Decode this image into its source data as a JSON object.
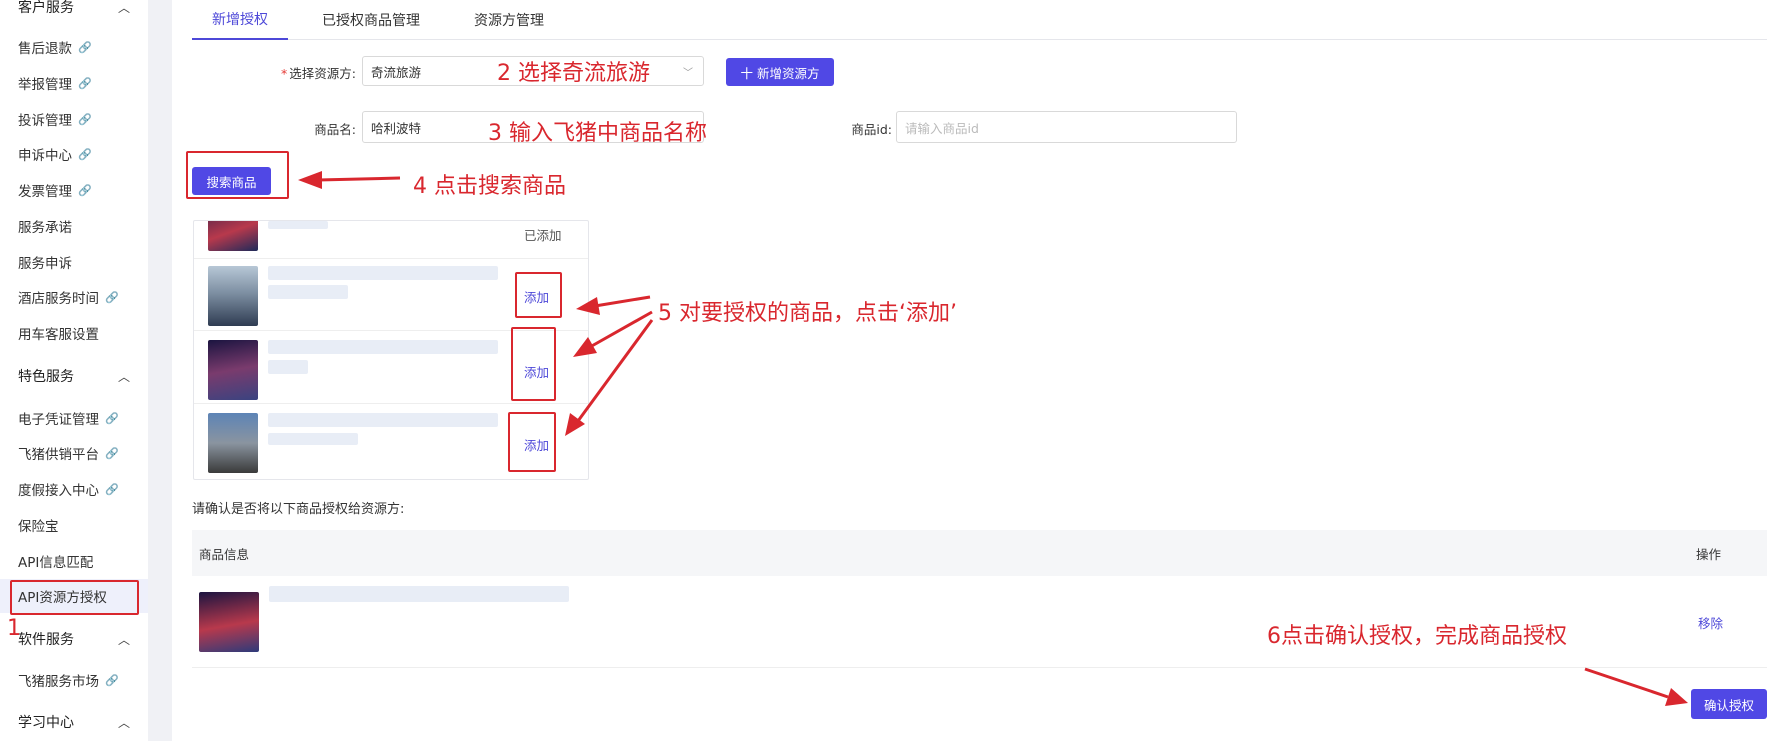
{
  "sidebar": {
    "sections": [
      {
        "label": "客户服务",
        "items": [
          {
            "label": "售后退款",
            "link": true
          },
          {
            "label": "举报管理",
            "link": true
          },
          {
            "label": "投诉管理",
            "link": true
          },
          {
            "label": "申诉中心",
            "link": true
          },
          {
            "label": "发票管理",
            "link": true
          },
          {
            "label": "服务承诺",
            "link": false
          },
          {
            "label": "服务申诉",
            "link": false
          },
          {
            "label": "酒店服务时间",
            "link": true
          },
          {
            "label": "用车客服设置",
            "link": false
          }
        ]
      },
      {
        "label": "特色服务",
        "items": [
          {
            "label": "电子凭证管理",
            "link": true
          },
          {
            "label": "飞猪供销平台",
            "link": true
          },
          {
            "label": "度假接入中心",
            "link": true
          },
          {
            "label": "保险宝",
            "link": false
          },
          {
            "label": "API信息匹配",
            "link": false
          },
          {
            "label": "API资源方授权",
            "link": false,
            "active": true
          }
        ]
      },
      {
        "label": "软件服务",
        "items": [
          {
            "label": "飞猪服务市场",
            "link": true
          }
        ]
      },
      {
        "label": "学习中心",
        "items": []
      }
    ],
    "link_icon": "🔗",
    "chevron_up": "^"
  },
  "tabs": [
    {
      "label": "新增授权",
      "active": true
    },
    {
      "label": "已授权商品管理",
      "active": false
    },
    {
      "label": "资源方管理",
      "active": false
    }
  ],
  "form": {
    "resource_label": "选择资源方:",
    "required_mark": "*",
    "resource_value": "奇流旅游",
    "add_resource_button": "十 新增资源方",
    "product_name_label": "商品名:",
    "product_name_value": "哈利波特",
    "product_id_label": "商品id:",
    "product_id_placeholder": "请输入商品id",
    "search_button": "搜索商品"
  },
  "results": {
    "added_label": "已添加",
    "add_label": "添加"
  },
  "confirm_prompt": "请确认是否将以下商品授权给资源方:",
  "table": {
    "col_info": "商品信息",
    "col_action": "操作",
    "remove_label": "移除"
  },
  "confirm_button": "确认授权",
  "annotations": {
    "step1": "1",
    "step2": "2 选择奇流旅游",
    "step3": "3 输入飞猪中商品名称",
    "step4": "4 点击搜索商品",
    "step5": "5 对要授权的商品，点击‘添加’",
    "step6": "6点击确认授权，完成商品授权"
  },
  "colors": {
    "accent": "#5048e5",
    "annotation_red": "#d9272e"
  }
}
